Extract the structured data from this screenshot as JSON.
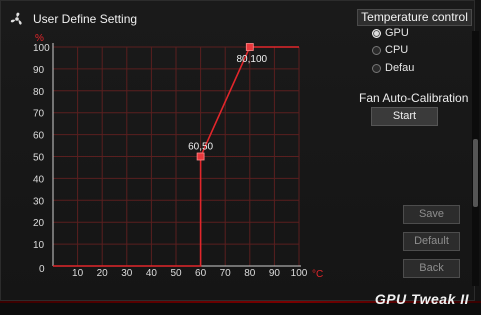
{
  "window": {
    "title": "User Define Setting",
    "title_icon": "fan-icon"
  },
  "chart_data": {
    "type": "line",
    "x": [
      0,
      60,
      60,
      80,
      100
    ],
    "y": [
      0,
      0,
      50,
      100,
      100
    ],
    "control_points": [
      {
        "x": 60,
        "y": 50,
        "label": "60,50"
      },
      {
        "x": 80,
        "y": 100,
        "label": "80,100"
      }
    ],
    "xticks": [
      "0",
      "10",
      "20",
      "30",
      "40",
      "50",
      "60",
      "70",
      "80",
      "90",
      "100"
    ],
    "yticks": [
      "0",
      "10",
      "20",
      "30",
      "40",
      "50",
      "60",
      "70",
      "80",
      "90",
      "100"
    ],
    "xunit": "°C",
    "yunit": "%",
    "xlim": [
      0,
      100
    ],
    "ylim": [
      0,
      100
    ],
    "grid": true,
    "line_color": "#e1262b",
    "grid_color": "#5a1f1f"
  },
  "temperature_control": {
    "label": "Temperature control",
    "options": [
      {
        "label": "GPU",
        "selected": true
      },
      {
        "label": "CPU",
        "selected": false
      },
      {
        "label": "Defau",
        "selected": false
      }
    ]
  },
  "calibration": {
    "label": "Fan Auto-Calibration",
    "start_label": "Start"
  },
  "buttons": {
    "save": "Save",
    "default": "Default",
    "back": "Back"
  },
  "brand": "GPU Tweak II",
  "colors": {
    "accent": "#e1262b",
    "background": "#151515"
  }
}
